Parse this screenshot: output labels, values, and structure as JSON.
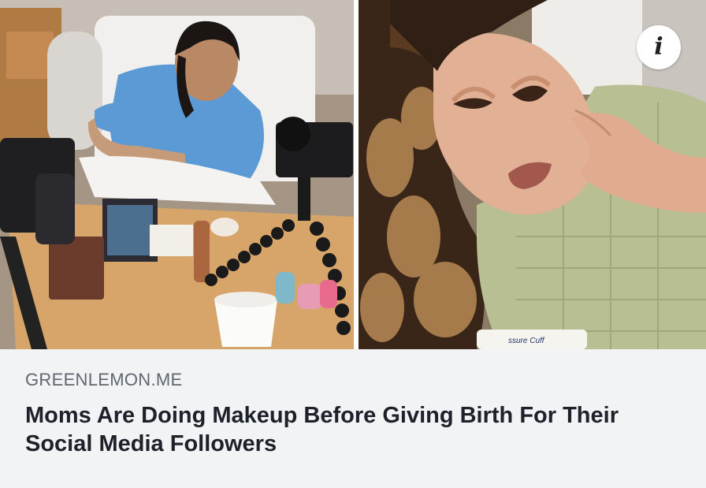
{
  "link_preview": {
    "info_icon": "info-icon",
    "left_image_subject": "woman-in-hospital-bed-filming-makeup",
    "right_image_subject": "woman-in-hospital-gown-wearing-makeup",
    "gown_label_text": "ssure Cuff",
    "domain": "GREENLEMON.ME",
    "headline": "Moms Are Doing Makeup Before Giving Birth For Their Social Media Followers"
  },
  "colors": {
    "caption_background": "#f2f3f5",
    "domain_text": "#606770",
    "headline_text": "#1d2129",
    "divider": "#ffffff"
  }
}
